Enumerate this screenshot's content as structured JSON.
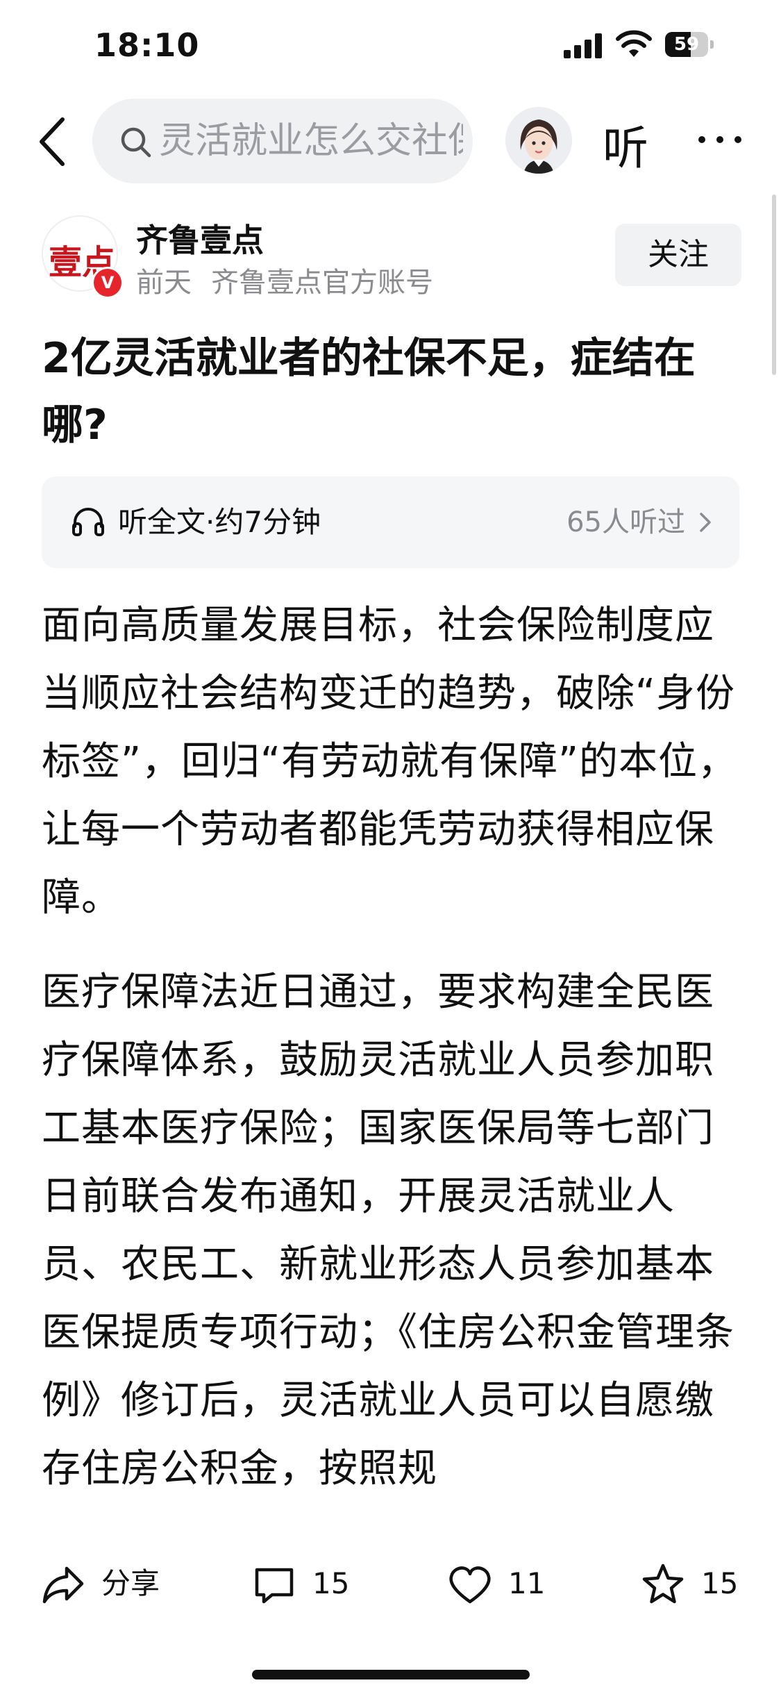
{
  "status_bar": {
    "time": "18:10",
    "battery": "59",
    "battery_level": 0.59
  },
  "nav": {
    "search_text": "灵活就业怎么交社保",
    "listen_label": "听"
  },
  "author": {
    "logo_text": "壹点",
    "badge": "V",
    "name": "齐鲁壹点",
    "time": "前天",
    "description": "齐鲁壹点官方账号",
    "follow_label": "关注"
  },
  "article": {
    "title": "2亿灵活就业者的社保不足，症结在哪?",
    "listen": {
      "label": "听全文·约7分钟",
      "count": "65人听过"
    },
    "paragraphs": [
      "面向高质量发展目标，社会保险制度应当顺应社会结构变迁的趋势，破除“身份标签”，回归“有劳动就有保障”的本位，让每一个劳动者都能凭劳动获得相应保障。",
      "医疗保障法近日通过，要求构建全民医疗保障体系，鼓励灵活就业人员参加职工基本医疗保险；国家医保局等七部门日前联合发布通知，开展灵活就业人员、农民工、新就业形态人员参加基本医保提质专项行动；《住房公积金管理条例》修订后，灵活就业人员可以自愿缴存住房公积金，按照规"
    ]
  },
  "actions": {
    "share_label": "分享",
    "comment_count": "15",
    "like_count": "11",
    "favorite_count": "15"
  }
}
